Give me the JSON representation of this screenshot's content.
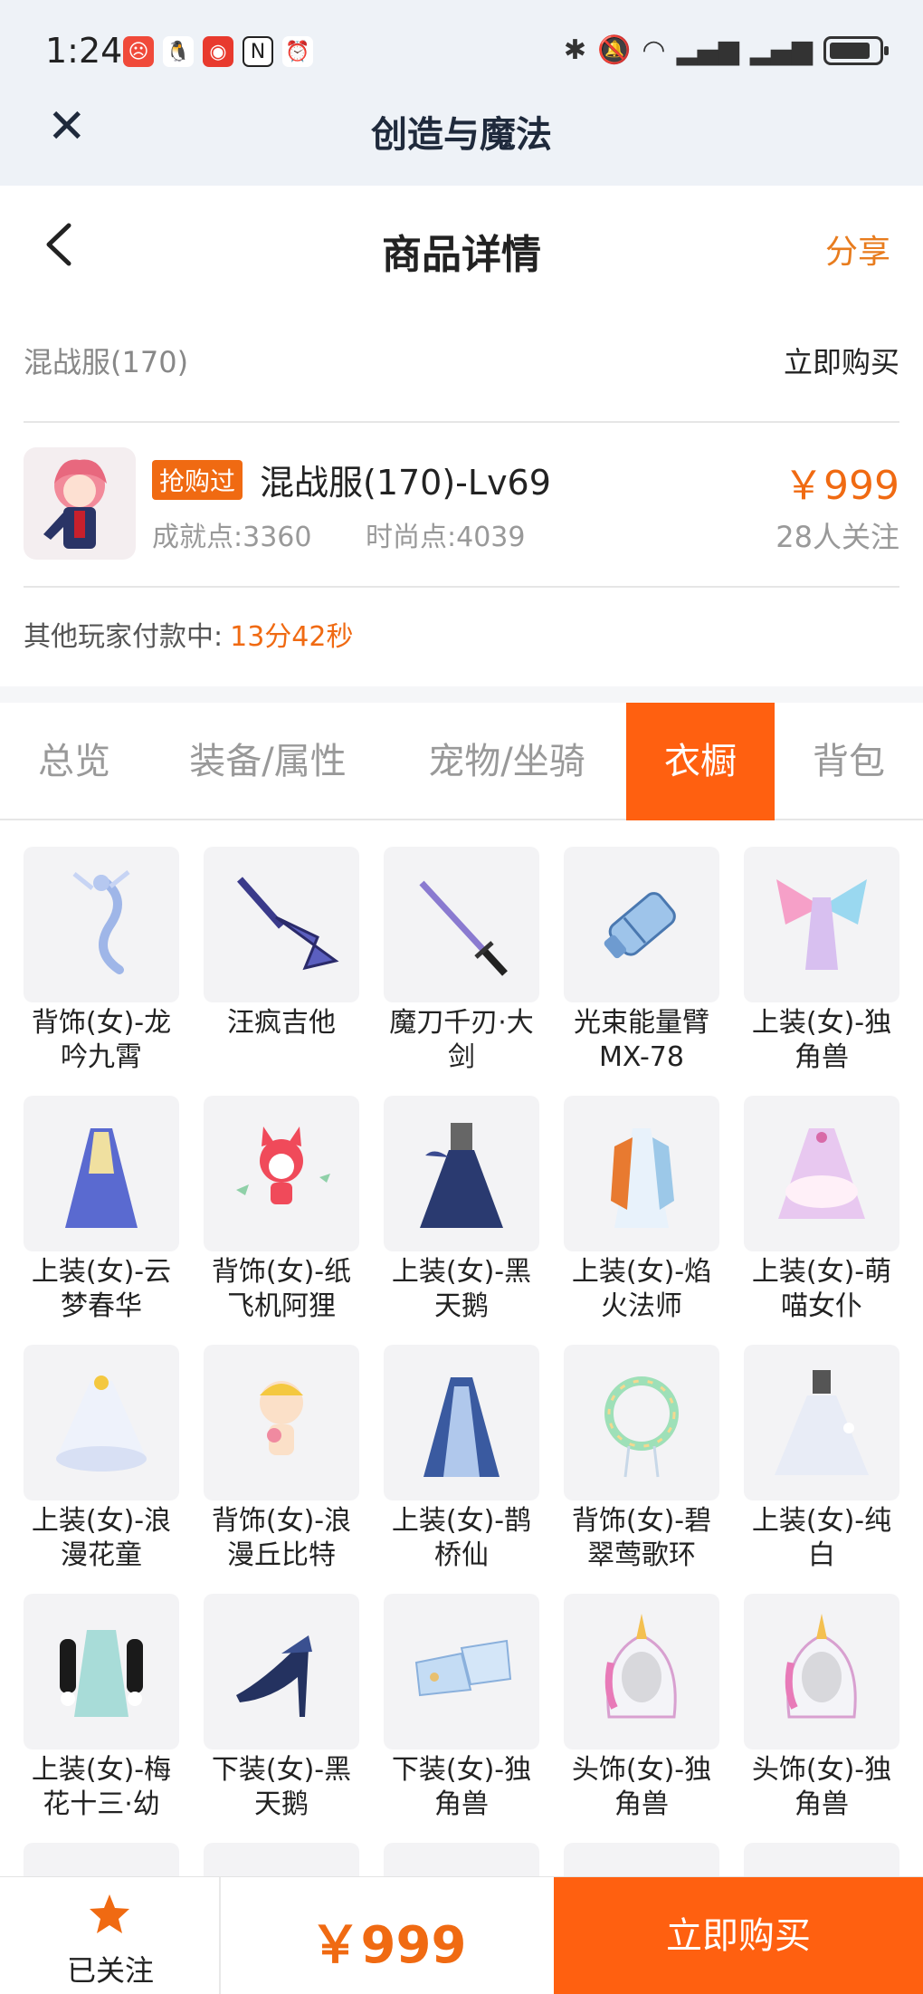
{
  "status": {
    "time": "1:24"
  },
  "app": {
    "title": "创造与魔法"
  },
  "nav": {
    "title": "商品详情",
    "share": "分享"
  },
  "seller": {
    "name": "混战服(170)",
    "buy_now": "立即购买"
  },
  "product": {
    "tag": "抢购过",
    "name": "混战服(170)-Lv69",
    "achievement": "成就点:3360",
    "fashion": "时尚点:4039",
    "price": "￥999",
    "followers": "28人关注"
  },
  "paying": {
    "label": "其他玩家付款中:",
    "time": "13分42秒"
  },
  "tabs": [
    {
      "label": "总览"
    },
    {
      "label": "装备/属性"
    },
    {
      "label": "宠物/坐骑"
    },
    {
      "label": "衣橱"
    },
    {
      "label": "背包"
    }
  ],
  "items": [
    {
      "name": "背饰(女)-龙吟九霄",
      "icon": "dragon-back-icon"
    },
    {
      "name": "汪疯吉他",
      "icon": "guitar-icon"
    },
    {
      "name": "魔刀千刃·大剑",
      "icon": "sword-icon"
    },
    {
      "name": "光束能量臂MX-78",
      "icon": "arm-cannon-icon"
    },
    {
      "name": "上装(女)-独角兽",
      "icon": "winged-dress-icon"
    },
    {
      "name": "上装(女)-云梦春华",
      "icon": "blue-gown-icon"
    },
    {
      "name": "背饰(女)-纸飞机阿狸",
      "icon": "fox-icon"
    },
    {
      "name": "上装(女)-黑天鹅",
      "icon": "navy-dress-icon"
    },
    {
      "name": "上装(女)-焰火法师",
      "icon": "mage-outfit-icon"
    },
    {
      "name": "上装(女)-萌喵女仆",
      "icon": "maid-dress-icon"
    },
    {
      "name": "上装(女)-浪漫花童",
      "icon": "white-dress-icon"
    },
    {
      "name": "背饰(女)-浪漫丘比特",
      "icon": "cupid-icon"
    },
    {
      "name": "上装(女)-鹊桥仙",
      "icon": "blue-gown-icon"
    },
    {
      "name": "背饰(女)-碧翠莺歌环",
      "icon": "wreath-icon"
    },
    {
      "name": "上装(女)-纯白",
      "icon": "wedding-dress-icon"
    },
    {
      "name": "上装(女)-梅花十三·幼",
      "icon": "qipao-icon"
    },
    {
      "name": "下装(女)-黑天鹅",
      "icon": "heels-icon"
    },
    {
      "name": "下装(女)-独角兽",
      "icon": "boots-icon"
    },
    {
      "name": "头饰(女)-独角兽",
      "icon": "unicorn-hood-icon"
    },
    {
      "name": "头饰(女)-独角兽",
      "icon": "unicorn-hood-icon"
    }
  ],
  "bottom": {
    "follow_label": "已关注",
    "price": "￥999",
    "buy_label": "立即购买"
  },
  "colors": {
    "accent": "#ff6010",
    "price": "#f06a12",
    "bg_header": "#eef2f7"
  }
}
